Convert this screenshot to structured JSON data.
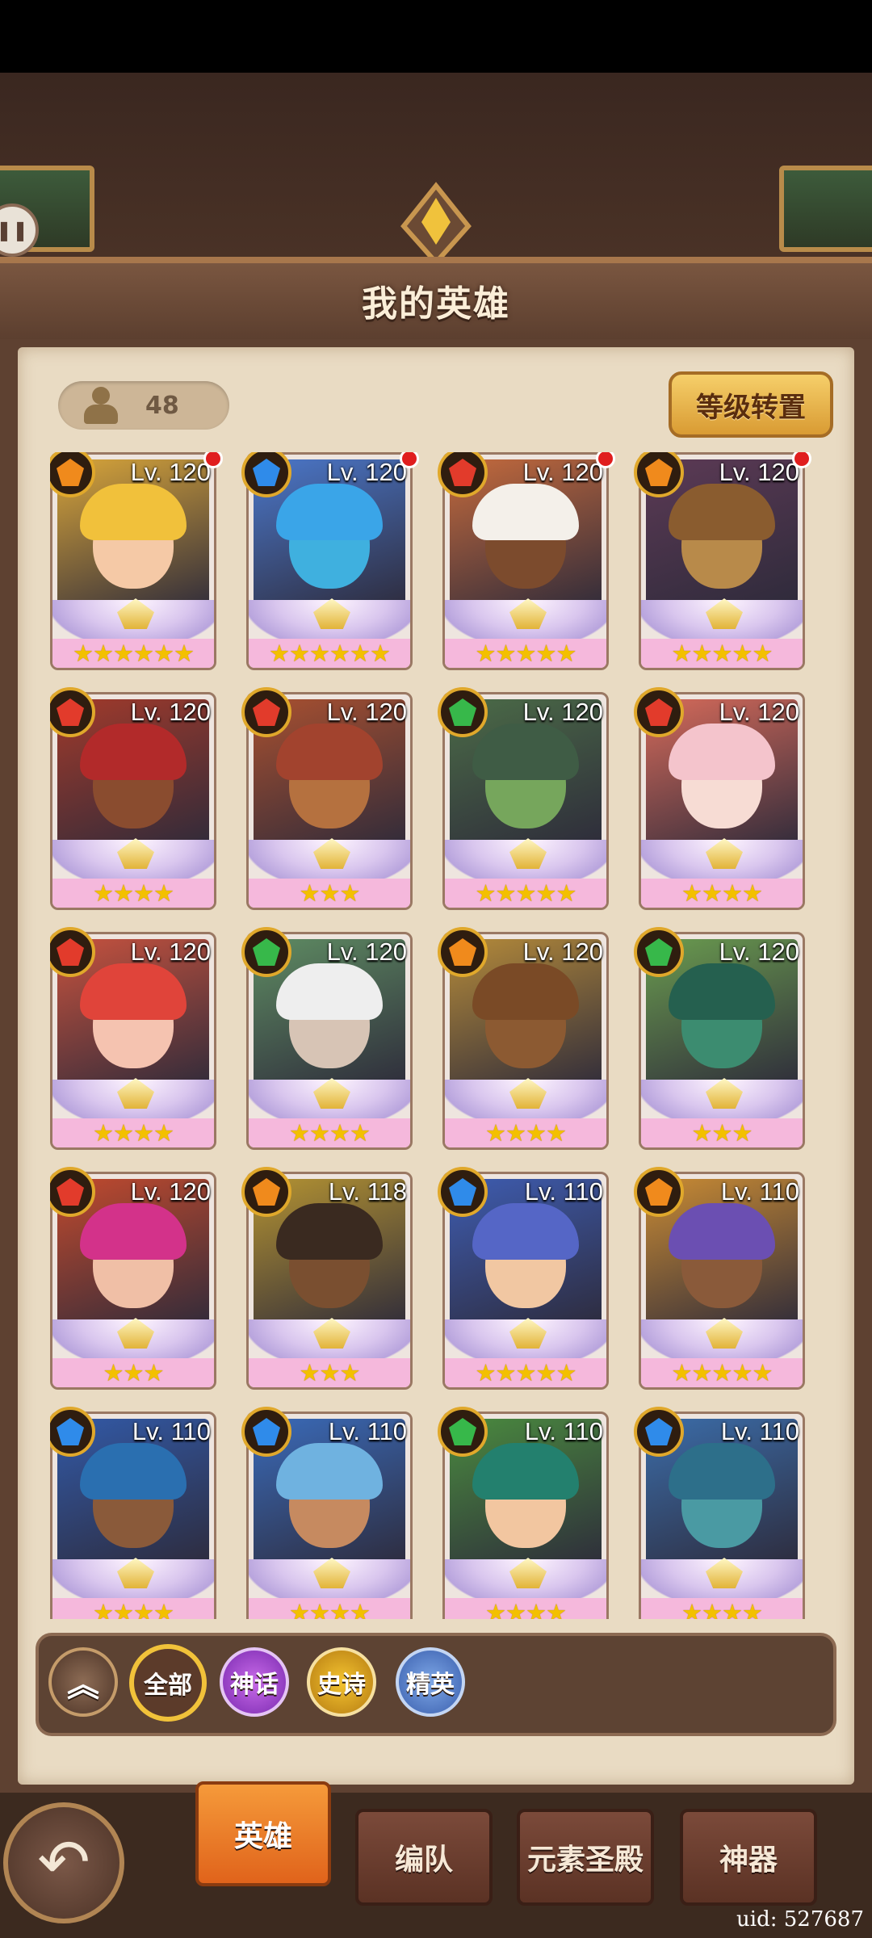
{
  "page": {
    "title": "我的英雄",
    "hero_count": "48",
    "reset_button": "等级转置",
    "uid": "uid: 527687"
  },
  "colors": {
    "fire": "#e23b2b",
    "water": "#2f8bea",
    "earth": "#f08a1c",
    "wind": "#37b84a"
  },
  "heroes": [
    {
      "level": "Lv. 120",
      "element": "earth",
      "stars": "★★★★★★",
      "alert": true,
      "skin": "#f5c9a6",
      "hair": "#f1c13b",
      "bg": "#d8a53a"
    },
    {
      "level": "Lv. 120",
      "element": "water",
      "stars": "★★★★★★",
      "alert": true,
      "skin": "#3fb0df",
      "hair": "#3aa5e8",
      "bg": "#4b77c9"
    },
    {
      "level": "Lv. 120",
      "element": "fire",
      "stars": "★★★★★",
      "alert": true,
      "skin": "#7c4b2d",
      "hair": "#f4f0ea",
      "bg": "#c46a3d"
    },
    {
      "level": "Lv. 120",
      "element": "earth",
      "stars": "★★★★★",
      "alert": true,
      "skin": "#b88a4a",
      "hair": "#8a5c2f",
      "bg": "#5c3a55"
    },
    {
      "level": "Lv. 120",
      "element": "fire",
      "stars": "★★★★",
      "alert": false,
      "skin": "#8a4c2f",
      "hair": "#b22a2a",
      "bg": "#a13a2b"
    },
    {
      "level": "Lv. 120",
      "element": "fire",
      "stars": "★★★",
      "alert": false,
      "skin": "#b5713f",
      "hair": "#a2432e",
      "bg": "#a85030"
    },
    {
      "level": "Lv. 120",
      "element": "wind",
      "stars": "★★★★★",
      "alert": false,
      "skin": "#76a65c",
      "hair": "#3f5c45",
      "bg": "#4b6b47"
    },
    {
      "level": "Lv. 120",
      "element": "fire",
      "stars": "★★★★",
      "alert": false,
      "skin": "#f7dcd4",
      "hair": "#f4c4cc",
      "bg": "#d56a5a"
    },
    {
      "level": "Lv. 120",
      "element": "fire",
      "stars": "★★★★",
      "alert": false,
      "skin": "#f5c3b0",
      "hair": "#e0443a",
      "bg": "#c6523e"
    },
    {
      "level": "Lv. 120",
      "element": "wind",
      "stars": "★★★★",
      "alert": false,
      "skin": "#d7c4b5",
      "hair": "#eeeeee",
      "bg": "#5e8b62"
    },
    {
      "level": "Lv. 120",
      "element": "earth",
      "stars": "★★★★",
      "alert": false,
      "skin": "#8c5a32",
      "hair": "#7a4a26",
      "bg": "#b48a3a"
    },
    {
      "level": "Lv. 120",
      "element": "wind",
      "stars": "★★★",
      "alert": false,
      "skin": "#3c8c70",
      "hair": "#25604f",
      "bg": "#6a9b4f"
    },
    {
      "level": "Lv. 120",
      "element": "fire",
      "stars": "★★★",
      "alert": false,
      "skin": "#f0bfa6",
      "hair": "#d3328a",
      "bg": "#c14a2e"
    },
    {
      "level": "Lv. 118",
      "element": "earth",
      "stars": "★★★",
      "alert": false,
      "skin": "#7a4f30",
      "hair": "#3a2a20",
      "bg": "#b39232"
    },
    {
      "level": "Lv. 110",
      "element": "water",
      "stars": "★★★★★",
      "alert": false,
      "skin": "#f1c7a2",
      "hair": "#5566c6",
      "bg": "#3e5cb0"
    },
    {
      "level": "Lv. 110",
      "element": "earth",
      "stars": "★★★★★",
      "alert": false,
      "skin": "#8a5a3a",
      "hair": "#6b4fb2",
      "bg": "#c98b34"
    },
    {
      "level": "Lv. 110",
      "element": "water",
      "stars": "★★★★",
      "alert": false,
      "skin": "#8a5a3a",
      "hair": "#2a6fb0",
      "bg": "#3259a6"
    },
    {
      "level": "Lv. 110",
      "element": "water",
      "stars": "★★★★",
      "alert": false,
      "skin": "#c68a60",
      "hair": "#6fb2e0",
      "bg": "#3a6ab8"
    },
    {
      "level": "Lv. 110",
      "element": "wind",
      "stars": "★★★★",
      "alert": false,
      "skin": "#f2c6a0",
      "hair": "#23806e",
      "bg": "#4a8a3f"
    },
    {
      "level": "Lv. 110",
      "element": "water",
      "stars": "★★★★",
      "alert": false,
      "skin": "#4a9aa3",
      "hair": "#2d6f8a",
      "bg": "#3b6ca8"
    }
  ],
  "filters": {
    "collapse": "collapse",
    "all": "全部",
    "myth": "神话",
    "epic": "史诗",
    "elite": "精英"
  },
  "tabs": {
    "heroes": "英雄",
    "team": "编队",
    "temple": "元素圣殿",
    "artifact": "神器"
  },
  "icons": {
    "back": "back-arrow-icon",
    "pause": "pause-icon"
  }
}
